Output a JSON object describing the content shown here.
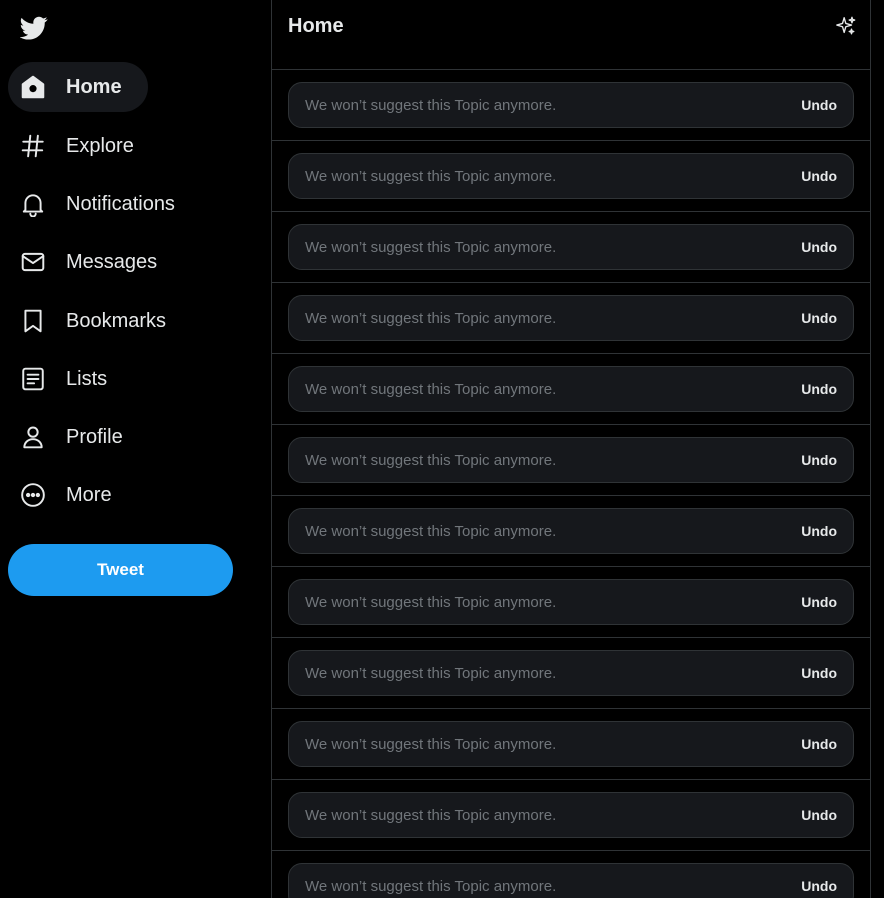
{
  "app": {
    "brand_icon": "twitter-bird-icon"
  },
  "sidebar": {
    "items": [
      {
        "label": "Home",
        "icon": "home-icon",
        "active": true
      },
      {
        "label": "Explore",
        "icon": "hashtag-icon",
        "active": false
      },
      {
        "label": "Notifications",
        "icon": "bell-icon",
        "active": false
      },
      {
        "label": "Messages",
        "icon": "envelope-icon",
        "active": false
      },
      {
        "label": "Bookmarks",
        "icon": "bookmark-icon",
        "active": false
      },
      {
        "label": "Lists",
        "icon": "list-icon",
        "active": false
      },
      {
        "label": "Profile",
        "icon": "person-icon",
        "active": false
      },
      {
        "label": "More",
        "icon": "more-circle-icon",
        "active": false
      }
    ],
    "tweet_label": "Tweet"
  },
  "header": {
    "title": "Home",
    "action_icon": "sparkle-icon"
  },
  "feed": {
    "items": [
      {
        "text": "We won’t suggest this Topic anymore.",
        "undo_label": "Undo"
      },
      {
        "text": "We won’t suggest this Topic anymore.",
        "undo_label": "Undo"
      },
      {
        "text": "We won’t suggest this Topic anymore.",
        "undo_label": "Undo"
      },
      {
        "text": "We won’t suggest this Topic anymore.",
        "undo_label": "Undo"
      },
      {
        "text": "We won’t suggest this Topic anymore.",
        "undo_label": "Undo"
      },
      {
        "text": "We won’t suggest this Topic anymore.",
        "undo_label": "Undo"
      },
      {
        "text": "We won’t suggest this Topic anymore.",
        "undo_label": "Undo"
      },
      {
        "text": "We won’t suggest this Topic anymore.",
        "undo_label": "Undo"
      },
      {
        "text": "We won’t suggest this Topic anymore.",
        "undo_label": "Undo"
      },
      {
        "text": "We won’t suggest this Topic anymore.",
        "undo_label": "Undo"
      },
      {
        "text": "We won’t suggest this Topic anymore.",
        "undo_label": "Undo"
      },
      {
        "text": "We won’t suggest this Topic anymore.",
        "undo_label": "Undo"
      }
    ]
  },
  "colors": {
    "background": "#000000",
    "text": "#e7e9ea",
    "muted_text": "#71767b",
    "border": "#2f3336",
    "card": "#16181c",
    "accent": "#1d9bf0"
  }
}
